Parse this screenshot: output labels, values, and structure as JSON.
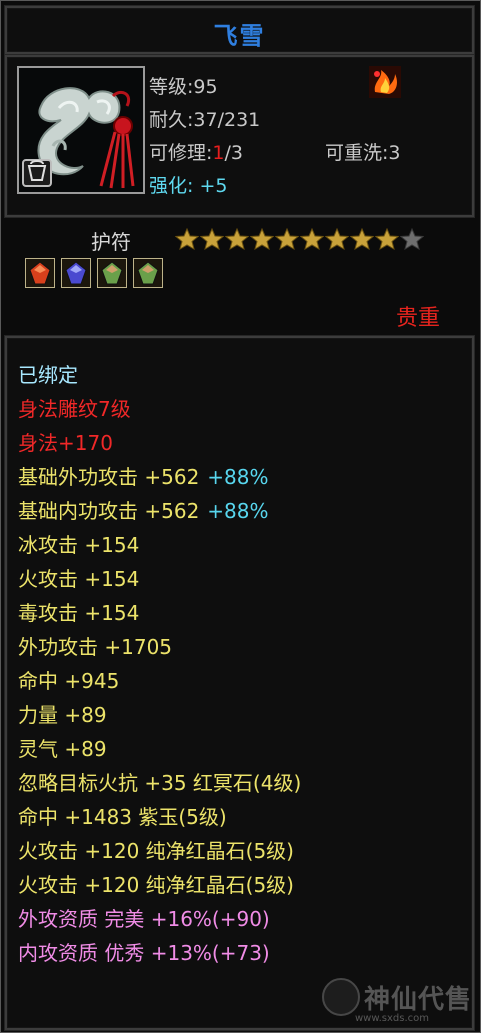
{
  "title": "飞雪",
  "item": {
    "icon": "amulet-icon",
    "level_line": "等级:95",
    "durability_line": "耐久:37/231",
    "repair_label": "可修理:",
    "repair_current": "1",
    "repair_total": "/3",
    "rewash_line": "可重洗:3",
    "enhance_label": "强化:",
    "enhance_value": "+5",
    "sub_icon": "flame-rune-icon"
  },
  "type_label": "护符",
  "stars": {
    "filled": 9,
    "total": 10
  },
  "gems": [
    "red-gem-icon",
    "purple-gem-icon",
    "jade-gem-icon",
    "jade-gem-icon"
  ],
  "rarity": "贵重",
  "attributes": [
    {
      "text": "已绑定",
      "color": "bound"
    },
    {
      "text": "身法雕纹7级",
      "color": "red"
    },
    {
      "text": "身法+170",
      "color": "red"
    },
    {
      "text": "基础外功攻击 +562",
      "extra": "+88%",
      "color": "yellow"
    },
    {
      "text": "基础内功攻击 +562",
      "extra": "+88%",
      "color": "yellow"
    },
    {
      "text": "冰攻击 +154",
      "color": "yellow"
    },
    {
      "text": "火攻击 +154",
      "color": "yellow"
    },
    {
      "text": "毒攻击 +154",
      "color": "yellow"
    },
    {
      "text": "外功攻击 +1705",
      "color": "yellow"
    },
    {
      "text": "命中 +945",
      "color": "yellow"
    },
    {
      "text": "力量 +89",
      "color": "yellow"
    },
    {
      "text": "灵气 +89",
      "color": "yellow"
    },
    {
      "text": "忽略目标火抗 +35 红冥石(4级)",
      "color": "yellow"
    },
    {
      "text": "命中 +1483 紫玉(5级)",
      "color": "yellow"
    },
    {
      "text": "火攻击 +120 纯净红晶石(5级)",
      "color": "yellow"
    },
    {
      "text": "火攻击 +120 纯净红晶石(5级)",
      "color": "yellow"
    },
    {
      "text": "外攻资质  完美 +16%(+90)",
      "color": "pink"
    },
    {
      "text": "内攻资质  优秀 +13%(+73)",
      "color": "pink"
    }
  ],
  "watermark": {
    "text": "神仙代售",
    "url": "www.sxds.com"
  },
  "colors": {
    "title": "#2f7fe0",
    "rarity": "#e6241e",
    "attr_yellow": "#ece36a",
    "attr_red": "#f02828",
    "attr_pink": "#f08ce6",
    "attr_cyan": "#58d6ee"
  }
}
